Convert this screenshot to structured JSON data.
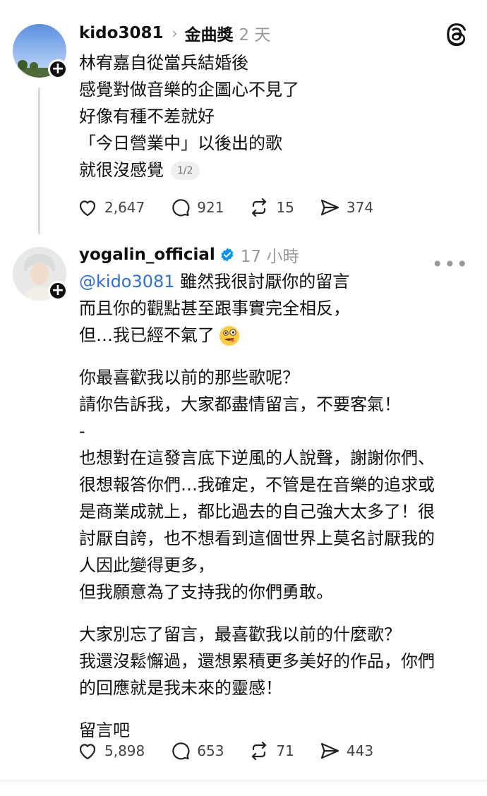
{
  "posts": [
    {
      "username": "kido3081",
      "topic": "金曲獎",
      "time": "2 天",
      "lines": [
        "林宥嘉自從當兵結婚後",
        "感覺對做音樂的企圖心不見了",
        "好像有種不差就好",
        "「今日營業中」以後出的歌",
        "就很沒感覺"
      ],
      "pager": "1/2",
      "likes": "2,647",
      "comments": "921",
      "reposts": "15",
      "shares": "374"
    },
    {
      "username": "yogalin_official",
      "time": "17 小時",
      "mention": "@kido3081",
      "lines": [
        "雖然我很討厭你的留言",
        "而且你的觀點甚至跟事實完全相反，",
        "但…我已經不氣了",
        "你最喜歡我以前的那些歌呢？",
        "請你告訴我，大家都盡情留言，不要客氣！",
        "-",
        "也想對在這發言底下逆風的人說聲，謝謝你們、",
        "很想報答你們…我確定，不管是在音樂的追求或",
        "是商業成就上，都比過去的自己強大太多了！很",
        "討厭自誇，也不想看到這個世界上莫名討厭我的",
        "人因此變得更多，",
        "但我願意為了支持我的你們勇敢。",
        "大家別忘了留言，最喜歡我以前的什麼歌？",
        "我還沒鬆懈過，還想累積更多美好的作品，你們",
        "的回應就是我未來的靈感！",
        "留言吧"
      ],
      "likes": "5,898",
      "comments": "653",
      "reposts": "71",
      "shares": "443"
    }
  ],
  "icons": [
    "threads-logo-icon",
    "more-icon",
    "verified-badge-icon",
    "heart-icon",
    "comment-icon",
    "repost-icon",
    "share-icon",
    "follow-plus-icon"
  ],
  "colors": {
    "mention": "#2f6fdc",
    "verified": "#0095f6",
    "muted": "#999999"
  }
}
